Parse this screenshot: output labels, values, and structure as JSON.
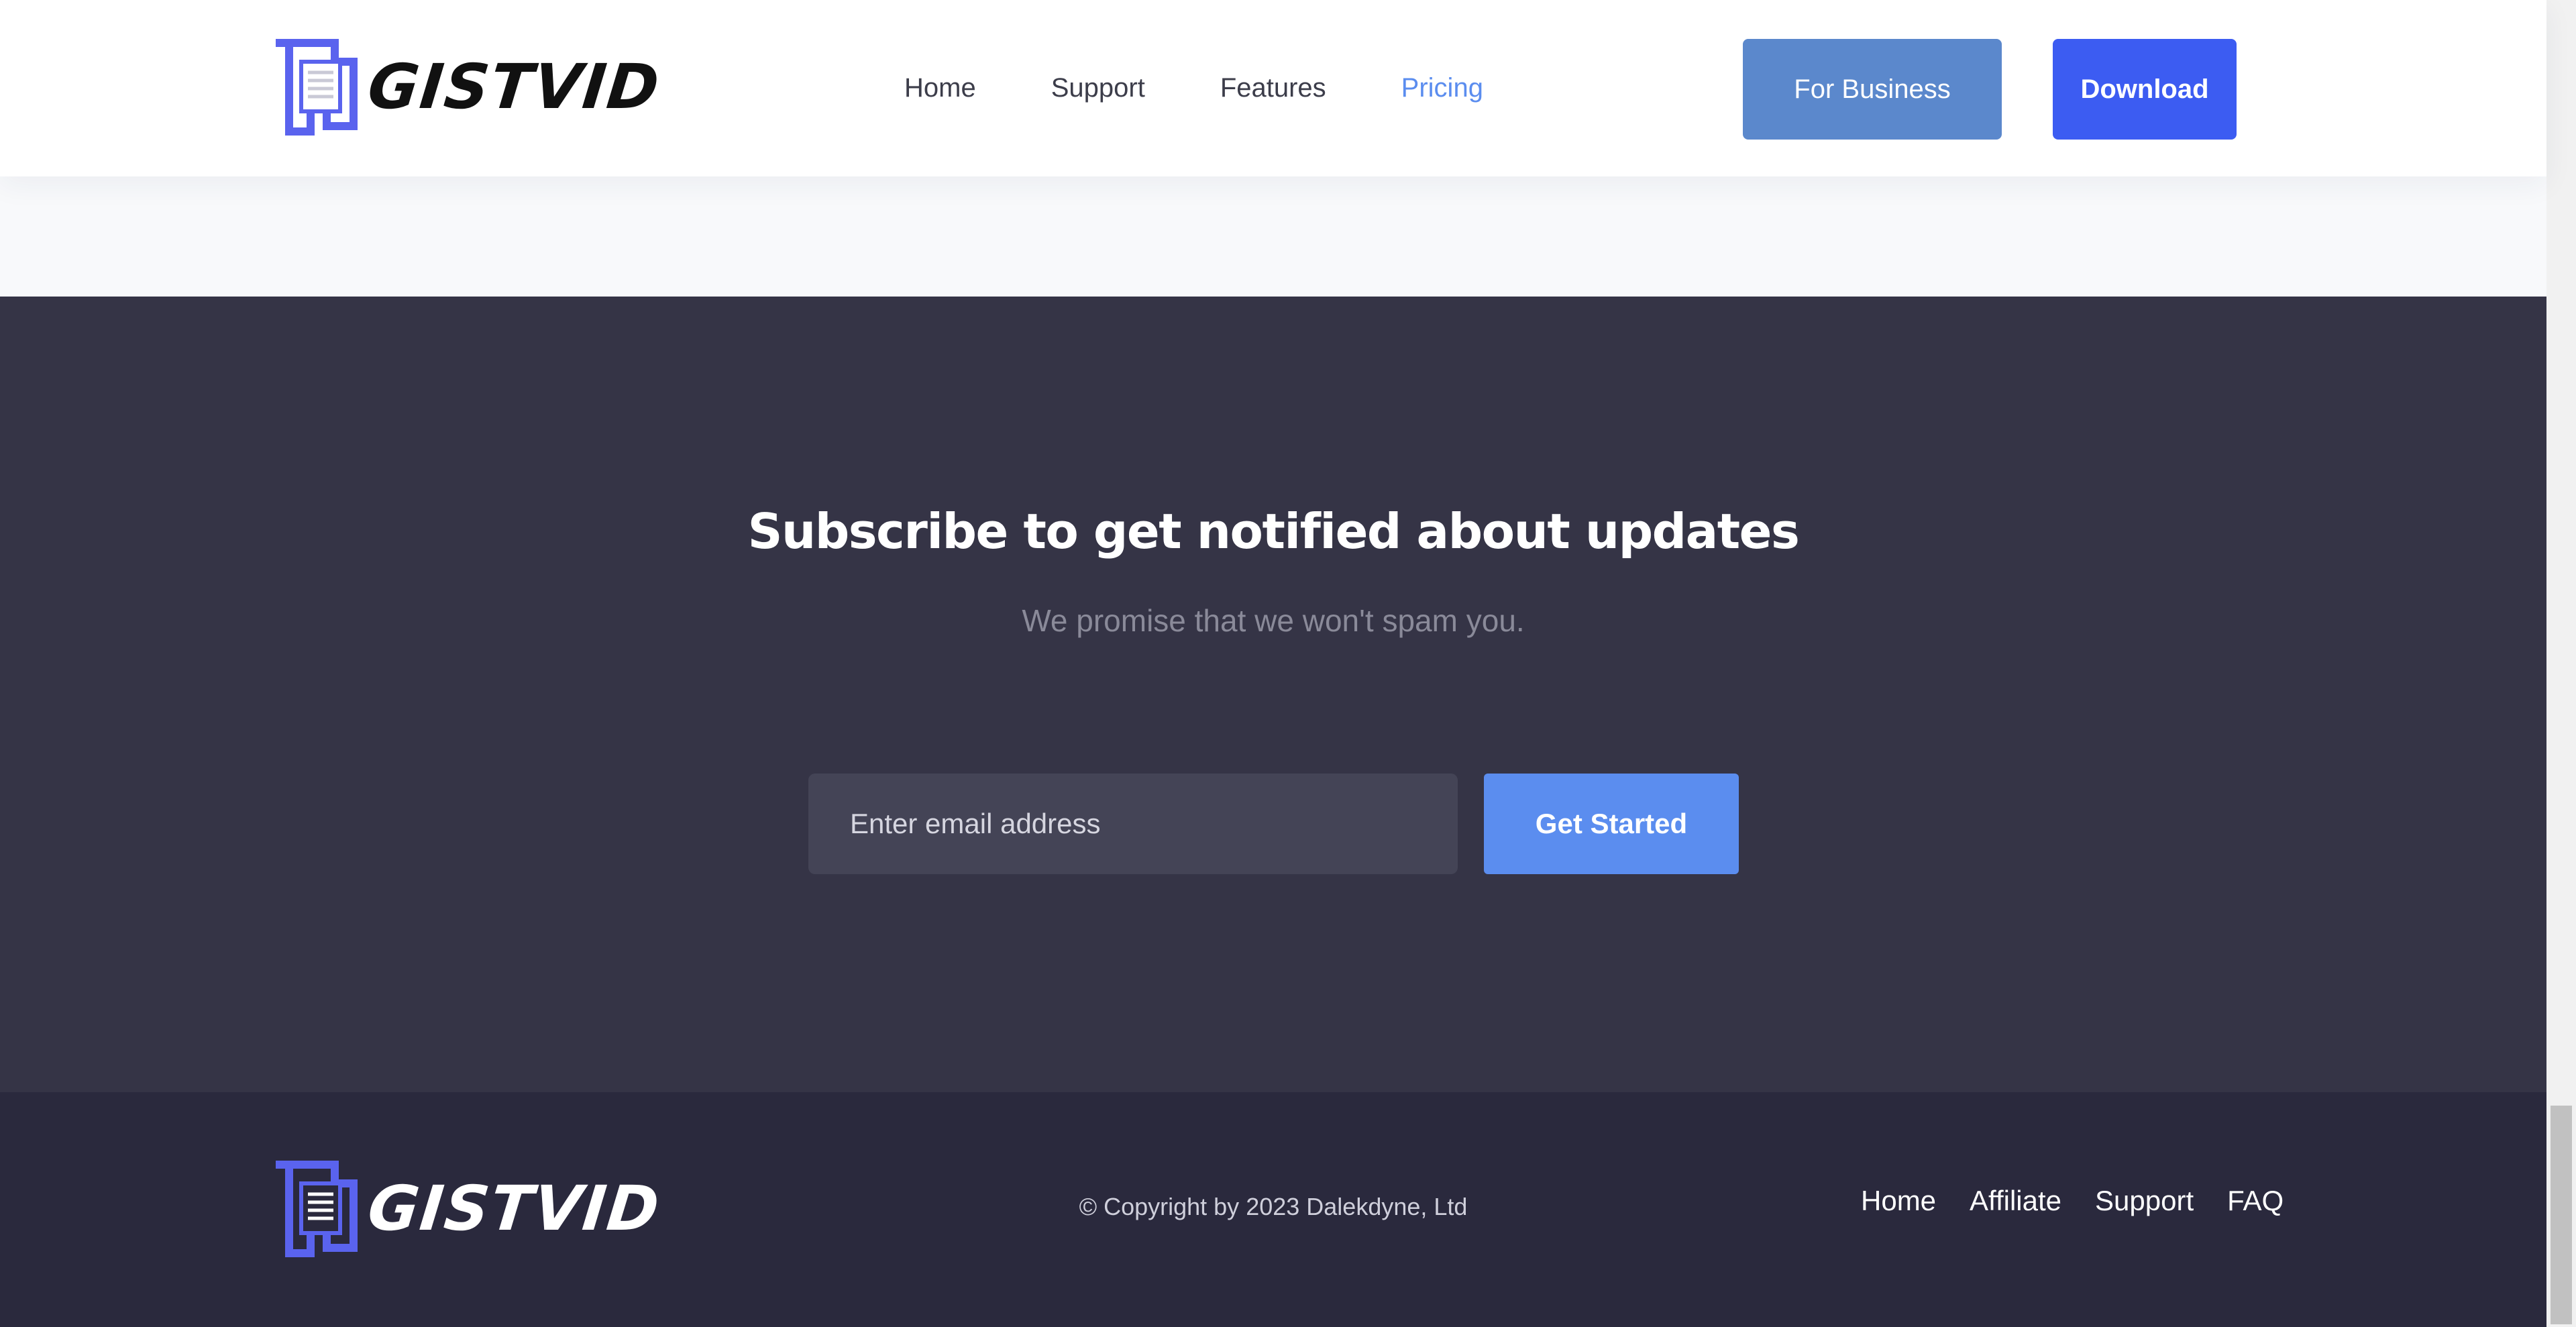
{
  "header": {
    "brand": "GISTVID",
    "nav": [
      "Home",
      "Support",
      "Features",
      "Pricing"
    ],
    "active_nav": "Pricing",
    "business_button": "For Business",
    "download_button": "Download"
  },
  "subscribe": {
    "title": "Subscribe to get notified about updates",
    "subtitle": "We promise that we won't spam you.",
    "email_placeholder": "Enter email address",
    "button": "Get Started"
  },
  "footer": {
    "brand": "GISTVID",
    "copyright": "© Copyright by 2023 Dalekdyne, Ltd",
    "links": [
      "Home",
      "Affiliate",
      "Support",
      "FAQ"
    ]
  },
  "colors": {
    "accent": "#5b8def",
    "download": "#3c5cf2",
    "business": "#5b88cc",
    "logo_blue": "#5a63ee",
    "section_dark": "#353446",
    "footer_dark": "#2a293d"
  },
  "icons": {
    "logo": "document-logo-icon"
  }
}
